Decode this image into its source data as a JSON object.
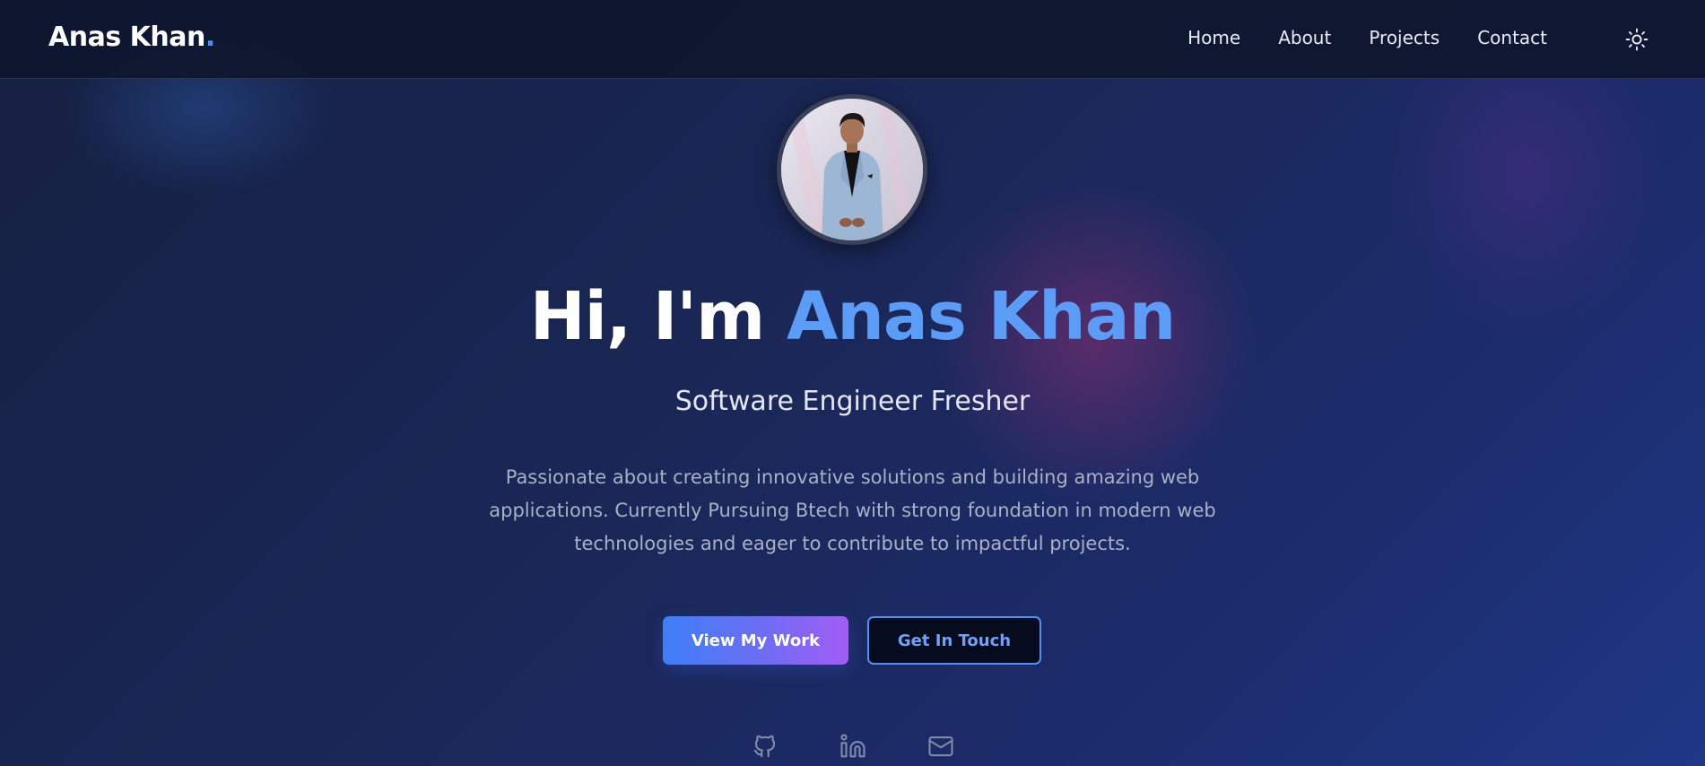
{
  "nav": {
    "brand_name": "Anas Khan",
    "brand_dot": ".",
    "links": [
      {
        "label": "Home"
      },
      {
        "label": "About"
      },
      {
        "label": "Projects"
      },
      {
        "label": "Contact"
      }
    ],
    "theme_toggle_icon": "sun-icon"
  },
  "hero": {
    "avatar_alt": "Profile photo",
    "greeting": "Hi, I'm ",
    "name": "Anas Khan",
    "role": "Software Engineer Fresher",
    "description": "Passionate about creating innovative solutions and building amazing web applications. Currently Pursuing Btech with strong foundation in modern web technologies and eager to contribute to impactful projects.",
    "primary_button": "View My Work",
    "secondary_button": "Get In Touch"
  },
  "socials": [
    {
      "icon": "github-icon"
    },
    {
      "icon": "linkedin-icon"
    },
    {
      "icon": "mail-icon"
    }
  ],
  "colors": {
    "accent": "#5b9cf6",
    "background": "#16214a",
    "button_gradient_start": "#3f7ff6",
    "button_gradient_end": "#a35cf4"
  }
}
